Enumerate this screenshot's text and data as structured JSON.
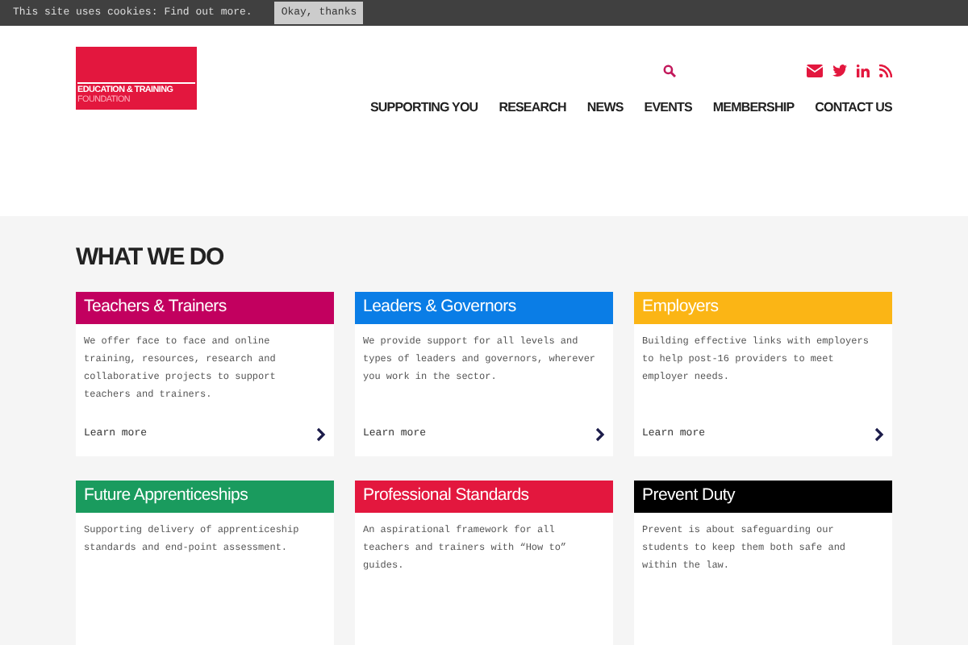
{
  "cookie_bar": {
    "message": "This site uses cookies:",
    "link": "Find out more.",
    "button": "Okay, thanks"
  },
  "logo": {
    "line1": "EDUCATION & TRAINING",
    "line2": "FOUNDATION"
  },
  "nav": [
    "SUPPORTING YOU",
    "RESEARCH",
    "NEWS",
    "EVENTS",
    "MEMBERSHIP",
    "CONTACT US"
  ],
  "section_title": "WHAT WE DO",
  "cards": [
    {
      "title": "Teachers & Trainers",
      "color": "#c2005f",
      "text": "We offer face to face and online training, resources, research and collaborative projects to support teachers and trainers.",
      "link": "Learn more"
    },
    {
      "title": "Leaders & Governors",
      "color": "#0a7de6",
      "text": "We provide support for all levels and types of leaders and governors, wherever you work in the sector.",
      "link": "Learn more"
    },
    {
      "title": "Employers",
      "color": "#fbb515",
      "text": "Building effective links with employers to help post-16 providers to meet employer needs.",
      "link": "Learn more"
    },
    {
      "title": "Future Apprenticeships",
      "color": "#1a9b5e",
      "text": "Supporting delivery of apprenticeship standards and end-point assessment."
    },
    {
      "title": "Professional Standards",
      "color": "#e3173e",
      "text": "An aspirational framework for all teachers and trainers with “How to” guides."
    },
    {
      "title": "Prevent Duty",
      "color": "#000000",
      "text": "Prevent is about safeguarding our students to keep them both safe and within the law."
    }
  ]
}
